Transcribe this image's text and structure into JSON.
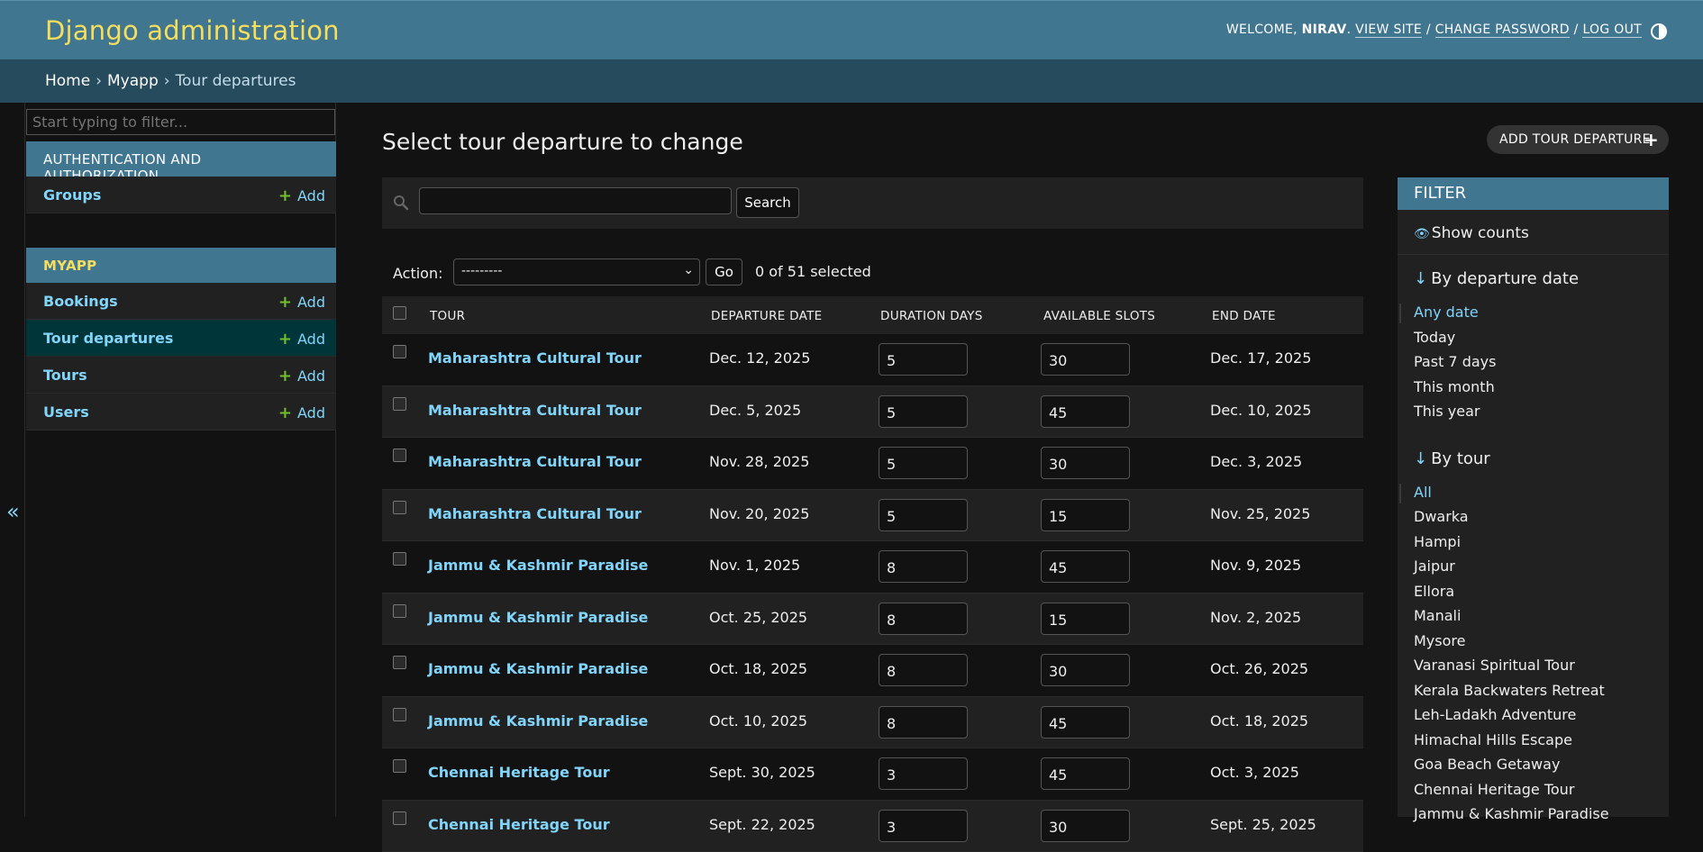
{
  "header": {
    "branding": "Django administration",
    "welcome": "WELCOME,",
    "username": "NIRAV",
    "view_site": "VIEW SITE",
    "change_password": "CHANGE PASSWORD",
    "log_out": "LOG OUT",
    "separator": "/"
  },
  "breadcrumbs": {
    "home": "Home",
    "app": "Myapp",
    "current": "Tour departures",
    "separator": "›"
  },
  "sidebar": {
    "filter_placeholder": "Start typing to filter...",
    "toggle_glyph": "«",
    "apps": [
      {
        "caption": "AUTHENTICATION AND AUTHORIZATION",
        "models": [
          {
            "name": "Groups",
            "add": "Add"
          }
        ]
      },
      {
        "caption": "MYAPP",
        "models": [
          {
            "name": "Bookings",
            "add": "Add"
          },
          {
            "name": "Tour departures",
            "add": "Add"
          },
          {
            "name": "Tours",
            "add": "Add"
          },
          {
            "name": "Users",
            "add": "Add"
          }
        ]
      }
    ]
  },
  "content": {
    "title": "Select tour departure to change",
    "add_button": "ADD TOUR DEPARTURE",
    "search_button": "Search",
    "search_value": "",
    "action_label": "Action:",
    "action_selected": "---------",
    "go_button": "Go",
    "selected_count": "0 of 51 selected"
  },
  "table": {
    "columns": [
      "TOUR",
      "DEPARTURE DATE",
      "DURATION DAYS",
      "AVAILABLE SLOTS",
      "END DATE"
    ],
    "rows": [
      {
        "tour": "Maharashtra Cultural Tour",
        "departure": "Dec. 12, 2025",
        "duration": "5",
        "slots": "30",
        "end": "Dec. 17, 2025"
      },
      {
        "tour": "Maharashtra Cultural Tour",
        "departure": "Dec. 5, 2025",
        "duration": "5",
        "slots": "45",
        "end": "Dec. 10, 2025"
      },
      {
        "tour": "Maharashtra Cultural Tour",
        "departure": "Nov. 28, 2025",
        "duration": "5",
        "slots": "30",
        "end": "Dec. 3, 2025"
      },
      {
        "tour": "Maharashtra Cultural Tour",
        "departure": "Nov. 20, 2025",
        "duration": "5",
        "slots": "15",
        "end": "Nov. 25, 2025"
      },
      {
        "tour": "Jammu & Kashmir Paradise",
        "departure": "Nov. 1, 2025",
        "duration": "8",
        "slots": "45",
        "end": "Nov. 9, 2025"
      },
      {
        "tour": "Jammu & Kashmir Paradise",
        "departure": "Oct. 25, 2025",
        "duration": "8",
        "slots": "15",
        "end": "Nov. 2, 2025"
      },
      {
        "tour": "Jammu & Kashmir Paradise",
        "departure": "Oct. 18, 2025",
        "duration": "8",
        "slots": "30",
        "end": "Oct. 26, 2025"
      },
      {
        "tour": "Jammu & Kashmir Paradise",
        "departure": "Oct. 10, 2025",
        "duration": "8",
        "slots": "45",
        "end": "Oct. 18, 2025"
      },
      {
        "tour": "Chennai Heritage Tour",
        "departure": "Sept. 30, 2025",
        "duration": "3",
        "slots": "45",
        "end": "Oct. 3, 2025"
      },
      {
        "tour": "Chennai Heritage Tour",
        "departure": "Sept. 22, 2025",
        "duration": "3",
        "slots": "30",
        "end": "Sept. 25, 2025"
      }
    ]
  },
  "filter": {
    "title": "FILTER",
    "show_counts": "Show counts",
    "arrow": "↓",
    "groups": [
      {
        "heading": "By departure date",
        "options": [
          "Any date",
          "Today",
          "Past 7 days",
          "This month",
          "This year"
        ],
        "selected": "Any date"
      },
      {
        "heading": "By tour",
        "options": [
          "All",
          "Dwarka",
          "Hampi",
          "Jaipur",
          "Ellora",
          "Manali",
          "Mysore",
          "Varanasi Spiritual Tour",
          "Kerala Backwaters Retreat",
          "Leh-Ladakh Adventure",
          "Himachal Hills Escape",
          "Goa Beach Getaway",
          "Chennai Heritage Tour",
          "Jammu & Kashmir Paradise"
        ],
        "selected": "All"
      }
    ]
  },
  "colors": {
    "header_bg": "#417690",
    "branding": "#f5dd5d",
    "breadcrumbs_bg": "#264b5d",
    "link": "#81d4fa",
    "add_plus": "#70bf2b",
    "selected_row": "#00363a",
    "page_bg": "#121212"
  }
}
